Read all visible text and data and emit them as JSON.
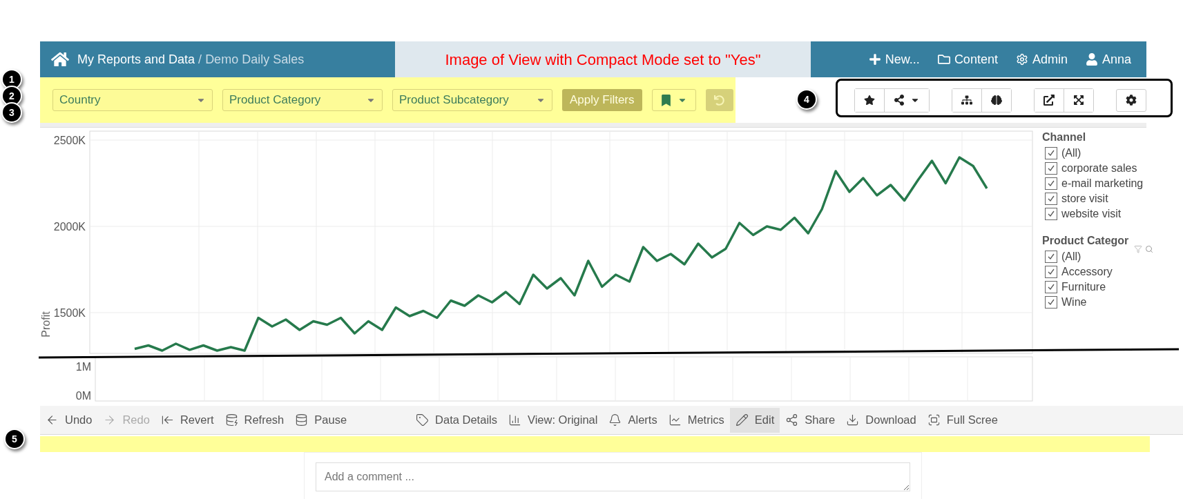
{
  "header": {
    "home": "My Reports and Data",
    "separator": "/",
    "report": "Demo Daily Sales",
    "nav": [
      {
        "kind": "plus",
        "label": "New..."
      },
      {
        "kind": "folder",
        "label": "Content"
      },
      {
        "kind": "gear",
        "label": "Admin"
      },
      {
        "kind": "user",
        "label": "Anna"
      }
    ]
  },
  "annotation_title": "Image of View with Compact Mode set to \"Yes\"",
  "filters": [
    "Country",
    "Product Category",
    "Product Subcategory"
  ],
  "apply_button": {
    "label": "Apply Filters",
    "disabled": true
  },
  "toolbar_groups": [
    {
      "buttons": [
        {
          "kind": "star",
          "menu": false
        },
        {
          "kind": "share",
          "menu": true
        }
      ]
    },
    {
      "buttons": [
        {
          "kind": "sitemap",
          "menu": false
        },
        {
          "kind": "brain",
          "menu": false
        }
      ]
    },
    {
      "buttons": [
        {
          "kind": "external",
          "menu": false
        },
        {
          "kind": "expand",
          "menu": false
        }
      ]
    },
    {
      "buttons": [
        {
          "kind": "gear",
          "menu": false
        }
      ]
    }
  ],
  "callouts": {
    "left_stack": [
      "1",
      "2",
      "3"
    ],
    "toolbar": "4",
    "footer": "5"
  },
  "chart": {
    "chart_data": {
      "type": "line",
      "ylabel": "Profit",
      "grid": true,
      "series": [
        {
          "color": "#267a4c",
          "values": [
            1290000,
            1310000,
            1280000,
            1320000,
            1285000,
            1310000,
            1280000,
            1300000,
            1280000,
            1470000,
            1420000,
            1460000,
            1400000,
            1450000,
            1430000,
            1470000,
            1380000,
            1450000,
            1400000,
            1530000,
            1480000,
            1510000,
            1470000,
            1570000,
            1540000,
            1600000,
            1560000,
            1620000,
            1550000,
            1720000,
            1640000,
            1700000,
            1600000,
            1800000,
            1650000,
            1720000,
            1680000,
            1880000,
            1800000,
            1840000,
            1780000,
            1900000,
            1820000,
            1870000,
            2020000,
            1950000,
            2000000,
            1980000,
            2050000,
            1960000,
            2100000,
            2320000,
            2200000,
            2280000,
            2180000,
            2240000,
            2150000,
            2270000,
            2380000,
            2250000,
            2400000,
            2350000,
            2220000
          ]
        }
      ],
      "ylim": [
        1264000,
        2552000
      ],
      "yticks": [
        {
          "value": 2500000,
          "label": "2500K"
        },
        {
          "value": 2000000,
          "label": "2000K"
        },
        {
          "value": 1500000,
          "label": "1500K"
        }
      ]
    },
    "lower_axis_labels": [
      "1M",
      "0M"
    ]
  },
  "legends": [
    {
      "title": "Channel",
      "tools": false,
      "items": [
        {
          "label": "(All)",
          "checked": true
        },
        {
          "label": "corporate sales",
          "checked": true
        },
        {
          "label": "e-mail marketing",
          "checked": true
        },
        {
          "label": "store visit",
          "checked": true
        },
        {
          "label": "website visit",
          "checked": true
        }
      ]
    },
    {
      "title": "Product Categor",
      "tools": true,
      "items": [
        {
          "label": "(All)",
          "checked": true
        },
        {
          "label": "Accessory",
          "checked": true
        },
        {
          "label": "Furniture",
          "checked": true
        },
        {
          "label": "Wine",
          "checked": true
        }
      ]
    }
  ],
  "bottom_toolbar": {
    "left": [
      {
        "kind": "undo",
        "label": "Undo",
        "disabled": false,
        "selected": false
      },
      {
        "kind": "redo",
        "label": "Redo",
        "disabled": true,
        "selected": false
      },
      {
        "kind": "revert",
        "label": "Revert",
        "disabled": false,
        "selected": false
      },
      {
        "kind": "refresh",
        "label": "Refresh",
        "disabled": false,
        "selected": false
      },
      {
        "kind": "pause",
        "label": "Pause",
        "disabled": false,
        "selected": false
      }
    ],
    "right": [
      {
        "kind": "tag",
        "label": "Data Details",
        "disabled": false,
        "selected": false
      },
      {
        "kind": "view",
        "label": "View: Original",
        "disabled": false,
        "selected": false
      },
      {
        "kind": "bell",
        "label": "Alerts",
        "disabled": false,
        "selected": false
      },
      {
        "kind": "metrics",
        "label": "Metrics",
        "disabled": false,
        "selected": false
      },
      {
        "kind": "pencil",
        "label": "Edit",
        "disabled": false,
        "selected": true
      },
      {
        "kind": "share",
        "label": "Share",
        "disabled": false,
        "selected": false
      },
      {
        "kind": "download",
        "label": "Download",
        "disabled": false,
        "selected": false
      },
      {
        "kind": "fullscreen",
        "label": "Full Scree",
        "disabled": false,
        "selected": false
      }
    ]
  },
  "comment": {
    "placeholder": "Add a comment ..."
  }
}
